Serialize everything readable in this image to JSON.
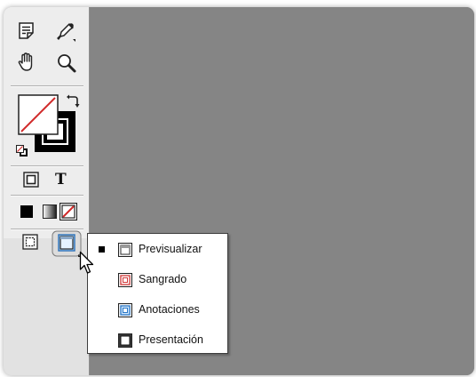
{
  "colors": {
    "workspace": "#858585",
    "toolbox": "#ededed",
    "none_swatch_slash": "#d12b2b",
    "bleed_red": "#d33a3a",
    "slug_blue": "#2a78c8"
  },
  "toolbox": {
    "tools": [
      {
        "name": "note-tool",
        "icon": "note-icon"
      },
      {
        "name": "eyedropper-tool",
        "icon": "eyedropper-icon"
      },
      {
        "name": "hand-tool",
        "icon": "hand-icon"
      },
      {
        "name": "zoom-tool",
        "icon": "magnifier-icon"
      }
    ],
    "formatting_text_label": "T",
    "screen_mode_current": "Previsualizar"
  },
  "flyout": {
    "items": [
      {
        "label": "Previsualizar",
        "icon": "preview-icon",
        "checked": true
      },
      {
        "label": "Sangrado",
        "icon": "bleed-icon",
        "checked": false
      },
      {
        "label": "Anotaciones",
        "icon": "slug-icon",
        "checked": false
      },
      {
        "label": "Presentación",
        "icon": "presentation-icon",
        "checked": false
      }
    ]
  }
}
